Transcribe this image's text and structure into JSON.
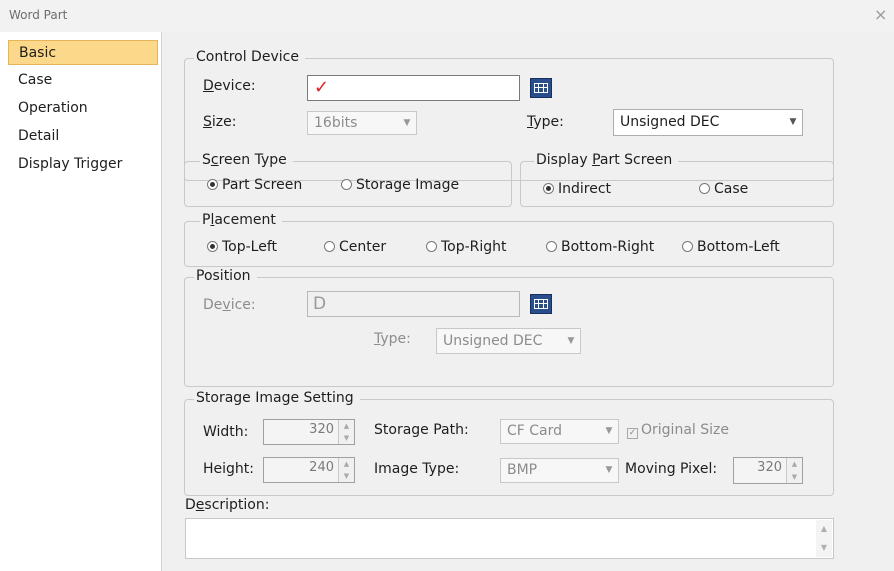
{
  "window": {
    "title": "Word Part",
    "close_glyph": "×"
  },
  "sidebar": {
    "items": [
      {
        "label": "Basic",
        "selected": true
      },
      {
        "label": "Case",
        "selected": false
      },
      {
        "label": "Operation",
        "selected": false
      },
      {
        "label": "Detail",
        "selected": false
      },
      {
        "label": "Display Trigger",
        "selected": false
      }
    ],
    "selected_color": "#fcd98a"
  },
  "control_device": {
    "title": "Control Device",
    "device_label_pre": "",
    "device_label_u": "D",
    "device_label_post": "evice:",
    "device_value": "✓",
    "size_label_u": "S",
    "size_label_post": "ize:",
    "size_value": "16bits",
    "type_label_u": "T",
    "type_label_post": "ype:",
    "type_value": "Unsigned DEC"
  },
  "screen_type": {
    "title_pre": "S",
    "title_u": "c",
    "title_post": "reen Type",
    "options": [
      "Part Screen",
      "Storage Image"
    ],
    "selected": "Part Screen"
  },
  "display_part_screen": {
    "title_pre": "Display ",
    "title_u": "P",
    "title_post": "art Screen",
    "options": [
      "Indirect",
      "Case"
    ],
    "selected": "Indirect"
  },
  "placement": {
    "title_pre": "P",
    "title_u": "l",
    "title_post": "acement",
    "options": [
      "Top-Left",
      "Center",
      "Top-Right",
      "Bottom-Right",
      "Bottom-Left"
    ],
    "selected": "Top-Left"
  },
  "position": {
    "title": "Position",
    "device_label_pre": "De",
    "device_label_u": "v",
    "device_label_post": "ice:",
    "device_value": "D",
    "type_label_u": "T",
    "type_label_post": "ype:",
    "type_value": "Unsigned DEC"
  },
  "storage_image_setting": {
    "title": "Storage Image Setting",
    "width_label": "Width:",
    "width_value": "320",
    "height_label": "Height:",
    "height_value": "240",
    "storage_path_label": "Storage Path:",
    "storage_path_value": "CF Card",
    "image_type_label": "Image Type:",
    "image_type_value": "BMP",
    "original_size_label": "Original Size",
    "original_size_checked": true,
    "moving_pixel_label": "Moving Pixel:",
    "moving_pixel_value": "320"
  },
  "description": {
    "label_pre": "D",
    "label_u": "e",
    "label_post": "scription:",
    "value": ""
  },
  "colors": {
    "check_mark": "#e02020",
    "device_button": "#2a4e8c",
    "panel_bg": "#f0f0f0"
  }
}
